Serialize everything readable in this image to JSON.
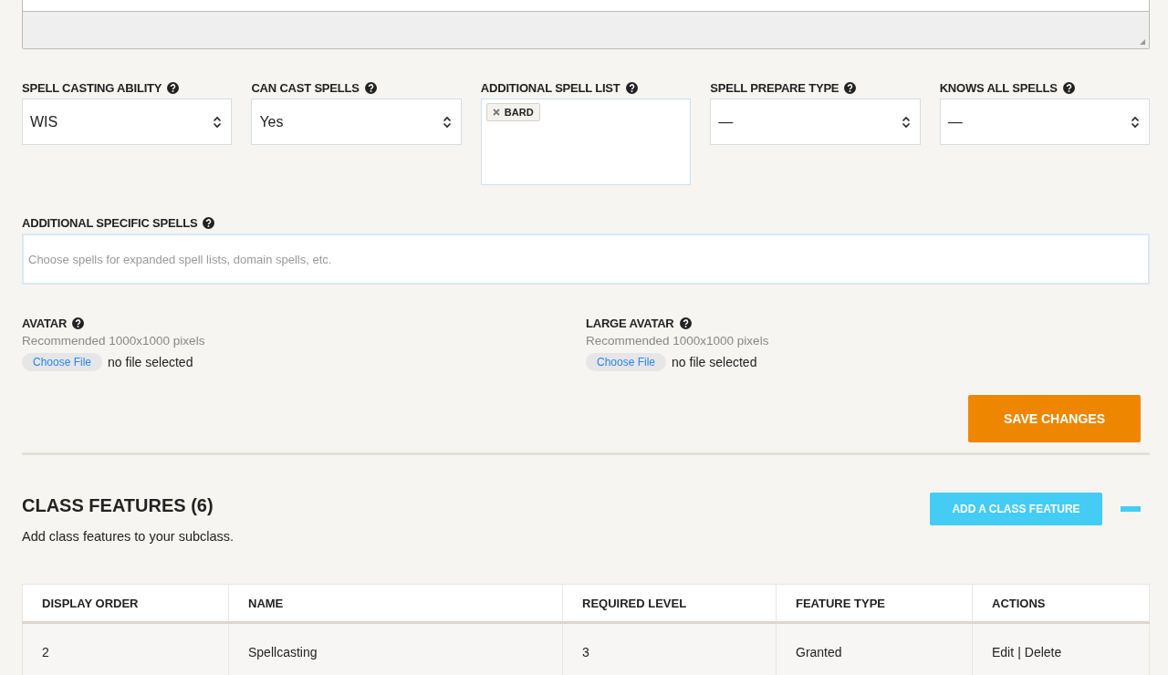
{
  "selects": [
    {
      "label": "SPELL CASTING ABILITY",
      "kind": "select",
      "value": "WIS"
    },
    {
      "label": "CAN CAST SPELLS",
      "kind": "select",
      "value": "Yes"
    },
    {
      "label": "ADDITIONAL SPELL LIST",
      "kind": "multi",
      "tags": [
        "BARD"
      ]
    },
    {
      "label": "SPELL PREPARE TYPE",
      "kind": "select",
      "value": "—"
    },
    {
      "label": "KNOWS ALL SPELLS",
      "kind": "select",
      "value": "—"
    }
  ],
  "specific_spells": {
    "label": "ADDITIONAL SPECIFIC SPELLS",
    "placeholder": "Choose spells for expanded spell lists, domain spells, etc."
  },
  "uploads": [
    {
      "label": "AVATAR",
      "hint": "Recommended 1000x1000 pixels",
      "button": "Choose File",
      "status": "no file selected"
    },
    {
      "label": "LARGE AVATAR",
      "hint": "Recommended 1000x1000 pixels",
      "button": "Choose File",
      "status": "no file selected"
    }
  ],
  "save_button": "SAVE CHANGES",
  "class_features": {
    "title": "CLASS FEATURES (6)",
    "description": "Add class features to your subclass.",
    "add_button": "ADD A CLASS FEATURE",
    "table": {
      "columns": [
        "DISPLAY ORDER",
        "NAME",
        "REQUIRED LEVEL",
        "FEATURE TYPE",
        "ACTIONS"
      ],
      "rows": [
        {
          "display_order": "2",
          "name": "Spellcasting",
          "required_level": "3",
          "feature_type": "Granted",
          "actions": [
            "Edit",
            "|",
            "Delete"
          ]
        }
      ]
    }
  }
}
